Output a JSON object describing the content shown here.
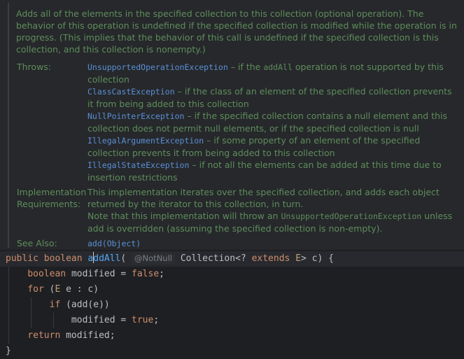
{
  "doc": {
    "description": "Adds all of the elements in the specified collection to this collection (optional operation). The behavior of this operation is undefined if the specified collection is modified while the operation is in progress. (This implies that the behavior of this call is undefined if the specified collection is this collection, and this collection is nonempty.)",
    "throws_label": "Throws:",
    "throws": [
      {
        "exception": "UnsupportedOperationException",
        "text_a": " – if the ",
        "code": "addAll",
        "text_b": " operation is not supported by this collection"
      },
      {
        "exception": "ClassCastException",
        "text_a": " – if the class of an element of the specified collection prevents it from being added to this collection",
        "code": "",
        "text_b": ""
      },
      {
        "exception": "NullPointerException",
        "text_a": " – if the specified collection contains a null element and this collection does not permit null elements, or if the specified collection is null",
        "code": "",
        "text_b": ""
      },
      {
        "exception": "IllegalArgumentException",
        "text_a": " – if some property of an element of the specified collection prevents it from being added to this collection",
        "code": "",
        "text_b": ""
      },
      {
        "exception": "IllegalStateException",
        "text_a": " – if not all the elements can be added at this time due to insertion restrictions",
        "code": "",
        "text_b": ""
      }
    ],
    "impl_label_1": "Implementation",
    "impl_label_2": "Requirements:",
    "impl_text_1": "This implementation iterates over the specified collection, and adds each object returned by the iterator to this collection, in turn.",
    "impl_text_2a": "Note that this implementation will throw an ",
    "impl_code": "UnsupportedOperationException",
    "impl_text_2b": " unless add is overridden (assuming the specified collection is non-empty).",
    "see_also_label": "See Also:",
    "see_also_link": "add(Object)"
  },
  "code": {
    "l1_public": "public",
    "l1_boolean": "boolean",
    "l1_name_a": "a",
    "l1_name_b": "ddAll",
    "l1_paren": "(",
    "l1_annotation": "@NotNull",
    "l1_type": "Collection<?",
    "l1_extends": "extends",
    "l1_E": "E",
    "l1_rest": "> c) {",
    "l2_boolean": "boolean",
    "l2_var": "modified = ",
    "l2_false": "false",
    "l2_end": ";",
    "l3_for": "for",
    "l3_open": " (",
    "l3_E": "E",
    "l3_rest": " e : c)",
    "l4_if": "if",
    "l4_rest": " (add(e))",
    "l5_var": "modified = ",
    "l5_true": "true",
    "l5_end": ";",
    "l6_return": "return",
    "l6_rest": " modified;",
    "l7": "}"
  }
}
